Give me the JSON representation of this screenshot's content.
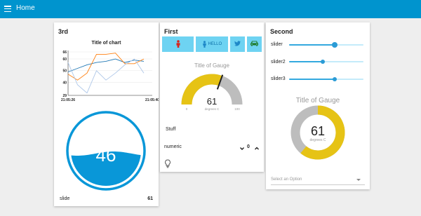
{
  "app": {
    "title": "Home"
  },
  "colors": {
    "accent": "#0094ce",
    "gauge_fill": "#e6c315",
    "gauge_rest": "#bdbdbd",
    "button": "#6ed3f2",
    "wave": "#0997d8"
  },
  "card_3rd": {
    "title": "3rd",
    "chart_data": {
      "type": "line",
      "title": "Title of chart",
      "xlabel": "",
      "ylabel": "",
      "x_tick_labels": [
        "21:05:26",
        "21:05:40"
      ],
      "y_tick_labels": [
        "29",
        "40",
        "50",
        "60",
        "66"
      ],
      "ylim": [
        29,
        66
      ],
      "grid": true,
      "series": [
        {
          "color": "#1f77b4",
          "values": [
            49,
            52,
            55,
            57,
            58,
            60,
            57,
            59,
            58
          ]
        },
        {
          "color": "#ff7f0e",
          "values": [
            47,
            42,
            48,
            64,
            64,
            65,
            56,
            56,
            60
          ]
        },
        {
          "color": "#aec7e8",
          "values": [
            57,
            38,
            31,
            50,
            42,
            48,
            55,
            60,
            48
          ]
        }
      ]
    },
    "liquid_gauge": {
      "value": 46,
      "fill_fraction": 0.46
    },
    "slide": {
      "label": "slide",
      "value": "61"
    }
  },
  "card_first": {
    "title": "First",
    "buttons": [
      {
        "icon": "person-icon",
        "label": ""
      },
      {
        "icon": "person-icon",
        "label": "HELLO"
      },
      {
        "icon": "twitter-icon",
        "label": ""
      },
      {
        "icon": "car-icon",
        "label": ""
      }
    ],
    "gauge": {
      "title": "Title of Gauge",
      "value": "61",
      "units": "degrees C",
      "min": "0",
      "max": "100",
      "fraction": 0.61
    },
    "stuff": {
      "label": "Stuff"
    },
    "numeric": {
      "label": "numeric",
      "value": "0"
    }
  },
  "card_second": {
    "title": "Second",
    "sliders": [
      {
        "label": "slider",
        "fraction": 0.61
      },
      {
        "label": "slider2",
        "fraction": 0.45
      },
      {
        "label": "slider3",
        "fraction": 0.61
      }
    ],
    "donut": {
      "title": "Title of Gauge",
      "value": "61",
      "units": "degrees C",
      "fraction": 0.61
    },
    "select": {
      "placeholder": "Select an Option"
    }
  }
}
